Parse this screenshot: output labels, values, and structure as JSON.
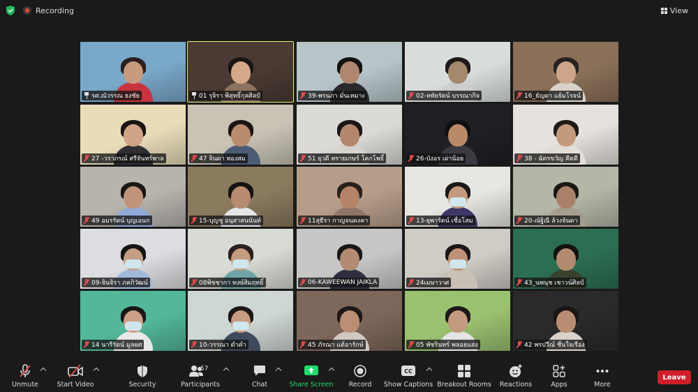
{
  "topbar": {
    "recording_label": "Recording",
    "view_label": "View"
  },
  "participants": [
    {
      "name": "รศ.ณัวรรณ ธงชัย",
      "pinned": true,
      "active": false,
      "bg": "#7aa8c9",
      "skin": "#c99b7e",
      "hair": "#2a2020",
      "shirt": "#c8343e",
      "mask": false
    },
    {
      "name": "01 รุจิรา พิสุทธิ์กุลศิลป์",
      "pinned": true,
      "active": true,
      "bg": "#4a3a33",
      "skin": "#d4a98a",
      "hair": "#1a1616",
      "shirt": "#8b7261",
      "mask": false
    },
    {
      "name": "39-พรนภา มั่นเหมาะ",
      "pinned": false,
      "active": false,
      "bg": "#b7c4c8",
      "skin": "#b08670",
      "hair": "#121010",
      "shirt": "#2a2a2e",
      "mask": false
    },
    {
      "name": "02-หทัยรัตน์ บรรณากิจ",
      "pinned": false,
      "active": false,
      "bg": "#d9dedc",
      "skin": "#a5896d",
      "hair": "#1f1a18",
      "shirt": "#cccccc",
      "mask": false
    },
    {
      "name": "16_ธัญดา แย้มโรจน์",
      "pinned": false,
      "active": false,
      "bg": "#8a7058",
      "skin": "#cca58a",
      "hair": "#2a2220",
      "shirt": "#d8d1c9",
      "mask": false
    },
    {
      "name": "27 -วราภรณ์ ศรีจันทร์พาล",
      "pinned": false,
      "active": false,
      "bg": "#e8dcb9",
      "skin": "#cfa385",
      "hair": "#1a1414",
      "shirt": "#2e2e34",
      "mask": false
    },
    {
      "name": "47 จินดา ทองสม",
      "pinned": false,
      "active": false,
      "bg": "#c9c3b6",
      "skin": "#b98b6f",
      "hair": "#1a1616",
      "shirt": "#4c5c75",
      "mask": false
    },
    {
      "name": "51 ยุวดี ทรายเกษร์ โคกโพธิ์",
      "pinned": false,
      "active": false,
      "bg": "#dcdad6",
      "skin": "#b4876c",
      "hair": "#1b1716",
      "shirt": "#d5d3cc",
      "mask": false
    },
    {
      "name": "26-บังอร เผ่าน้อย",
      "pinned": false,
      "active": false,
      "bg": "#1e2024",
      "skin": "#b88a6a",
      "hair": "#110f0f",
      "shirt": "#3a3a40",
      "mask": false
    },
    {
      "name": "38 - ฉัตรขวัญ คีตดี",
      "pinned": false,
      "active": false,
      "bg": "#e5e1dc",
      "skin": "#c49a7d",
      "hair": "#1e1a18",
      "shirt": "#e2ddd6",
      "mask": false
    },
    {
      "name": "49 อมรรัตน์ บุญเอนก",
      "pinned": false,
      "active": false,
      "bg": "#b8b3ad",
      "skin": "#c09478",
      "hair": "#1b1616",
      "shirt": "#90a9d6",
      "mask": false
    },
    {
      "name": "15-บุญชู อนุสาสนนันท์",
      "pinned": false,
      "active": false,
      "bg": "#8a7a5e",
      "skin": "#b78b70",
      "hair": "#151212",
      "shirt": "#e6e6e6",
      "mask": false
    },
    {
      "name": "11สุธีรา กาญจนคงคา",
      "pinned": false,
      "active": false,
      "bg": "#b69d89",
      "skin": "#b58468",
      "hair": "#2a211c",
      "shirt": "#8f7566",
      "mask": false
    },
    {
      "name": "13-ยุพารัตน์ เชื่อโสม",
      "pinned": false,
      "active": false,
      "bg": "#e8e6e2",
      "skin": "#c39a80",
      "hair": "#1c1818",
      "shirt": "#3f3668",
      "mask": true
    },
    {
      "name": "20-ณัฐิณี ล้วงจันดา",
      "pinned": false,
      "active": false,
      "bg": "#b3b7a7",
      "skin": "#a98168",
      "hair": "#1b1717",
      "shirt": "#a59e8f",
      "mask": false
    },
    {
      "name": "09-จินจิรา ภคกิวัฒน์",
      "pinned": false,
      "active": false,
      "bg": "#dcdde0",
      "skin": "#c59e84",
      "hair": "#161313",
      "shirt": "#a2b8d8",
      "mask": true
    },
    {
      "name": "08พิชชากา ทงษ์สิมฤทธิ์",
      "pinned": false,
      "active": false,
      "bg": "#d8dad4",
      "skin": "#c29b80",
      "hair": "#2a2020",
      "shirt": "#6fa5a8",
      "mask": true
    },
    {
      "name": "06-KAWEEWAN JAIKLA",
      "pinned": false,
      "active": false,
      "bg": "#c7c8c5",
      "skin": "#b38b72",
      "hair": "#1c1818",
      "shirt": "#2e3040",
      "mask": false
    },
    {
      "name": "24เมษาวาศ",
      "pinned": false,
      "active": false,
      "bg": "#cfcbc5",
      "skin": "#bd9276",
      "hair": "#1b1717",
      "shirt": "#c9c1b6",
      "mask": true
    },
    {
      "name": "43_นพนุช เชาวน์ศิลป์",
      "pinned": false,
      "active": false,
      "bg": "#2c6e52",
      "skin": "#b28a6f",
      "hair": "#151212",
      "shirt": "#38402e",
      "mask": false
    },
    {
      "name": "14 นารีรัตน์ มูลยศ",
      "pinned": false,
      "active": false,
      "bg": "#53b89a",
      "skin": "#cba087",
      "hair": "#1b1717",
      "shirt": "#e8e8e8",
      "mask": true
    },
    {
      "name": "10-วรรณา ดำคำ",
      "pinned": false,
      "active": false,
      "bg": "#cfd7d4",
      "skin": "#c79c81",
      "hair": "#1c1818",
      "shirt": "#3f4a5c",
      "mask": true
    },
    {
      "name": "45 ภัรณา แต้อารักษ์",
      "pinned": false,
      "active": false,
      "bg": "#7d675a",
      "skin": "#bb8f73",
      "hair": "#1e1818",
      "shirt": "#d0c8c2",
      "mask": false
    },
    {
      "name": "05 พัชรินทร์ พลอยแสง",
      "pinned": false,
      "active": false,
      "bg": "#9ac170",
      "skin": "#c49a7f",
      "hair": "#1d1818",
      "shirt": "#e4e4e4",
      "mask": false
    },
    {
      "name": "42 พรปวีณ์ ชื่นใจเรือง",
      "pinned": false,
      "active": false,
      "bg": "#2a2a2a",
      "skin": "#b98d72",
      "hair": "#1a1616",
      "shirt": "#d9d2cb",
      "mask": false
    }
  ],
  "toolbar": {
    "unmute": "Unmute",
    "start_video": "Start Video",
    "security": "Security",
    "participants": "Participants",
    "participants_count": "57",
    "chat": "Chat",
    "share_screen": "Share Screen",
    "record": "Record",
    "show_captions": "Show Captions",
    "breakout_rooms": "Breakout Rooms",
    "reactions": "Reactions",
    "apps": "Apps",
    "more": "More",
    "leave": "Leave",
    "cc_text": "CC"
  },
  "colors": {
    "active_speaker_border": "#e6f16e",
    "share_green": "#23d96c",
    "leave_red": "#cf1f2b",
    "muted_red": "#e04a4a"
  }
}
